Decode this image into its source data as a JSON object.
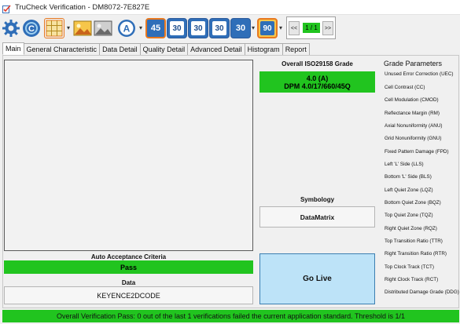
{
  "window": {
    "title": "TruCheck Verification - DM8072-7E827E"
  },
  "toolbar": {
    "buttons": [
      {
        "icon": "gear-icon"
      },
      {
        "icon": "c-logo-icon"
      },
      {
        "icon": "grid-icon"
      },
      {
        "icon": "image-color-icon"
      },
      {
        "icon": "image-gray-icon"
      },
      {
        "icon": "a-badge-icon"
      },
      {
        "icon": "angle-45-icon",
        "label": "45"
      },
      {
        "icon": "mode-30-icon-1",
        "label": "30"
      },
      {
        "icon": "mode-30-icon-2",
        "label": "30"
      },
      {
        "icon": "mode-30-icon-3",
        "label": "30"
      },
      {
        "icon": "mode-30-icon-4",
        "label": "30"
      },
      {
        "icon": "angle-90-icon",
        "label": "90"
      }
    ],
    "dropdown_glyph": "▾",
    "nav": {
      "prev": "<<",
      "page": "1 / 1",
      "next": ">>"
    }
  },
  "tabs": [
    {
      "label": "Main",
      "active": true
    },
    {
      "label": "General Characteristic"
    },
    {
      "label": "Data Detail"
    },
    {
      "label": "Quality Detail"
    },
    {
      "label": "Advanced Detail"
    },
    {
      "label": "Histogram"
    },
    {
      "label": "Report"
    }
  ],
  "main": {
    "overall_grade_title": "Overall ISO29158 Grade",
    "grade_line1": "4.0 (A)",
    "grade_line2": "DPM 4.0/17/660/45Q",
    "symbology_title": "Symbology",
    "symbology_value": "DataMatrix",
    "auto_acceptance_title": "Auto Acceptance Criteria",
    "auto_acceptance_value": "Pass",
    "data_title": "Data",
    "data_value": "KEYENCE2DCODE",
    "go_live": "Go Live"
  },
  "grade_parameters": {
    "title": "Grade Parameters",
    "items": [
      "Unused Error Correction (UEC)",
      "Cell Contrast (CC)",
      "Cell Modulation (CMOD)",
      "Reflectance Margin (RM)",
      "Axial Nonuniformity (ANU)",
      "Grid Nonuniformity (GNU)",
      "Fixed Pattern Damage (FPD)",
      "Left 'L' Side (LLS)",
      "Bottom 'L' Side (BLS)",
      "Left Quiet Zone (LQZ)",
      "Bottom Quiet Zone (BQZ)",
      "Top Quiet Zone (TQZ)",
      "Right Quiet Zone (RQZ)",
      "Top Transition Ratio (TTR)",
      "Right Transition Ratio (RTR)",
      "Top Clock Track (TCT)",
      "Right Clock Track (RCT)",
      "Distributed Damage Grade (DDG)"
    ]
  },
  "status": {
    "text": "Overall Verification Pass: 0 out of the last 1 verifications failed the current application standard. Threshold is 1/1"
  },
  "colors": {
    "pass_green": "#21c41f",
    "go_live_blue": "#bde3f8",
    "accent_blue": "#2f6eb8",
    "orange": "#e8781e"
  }
}
